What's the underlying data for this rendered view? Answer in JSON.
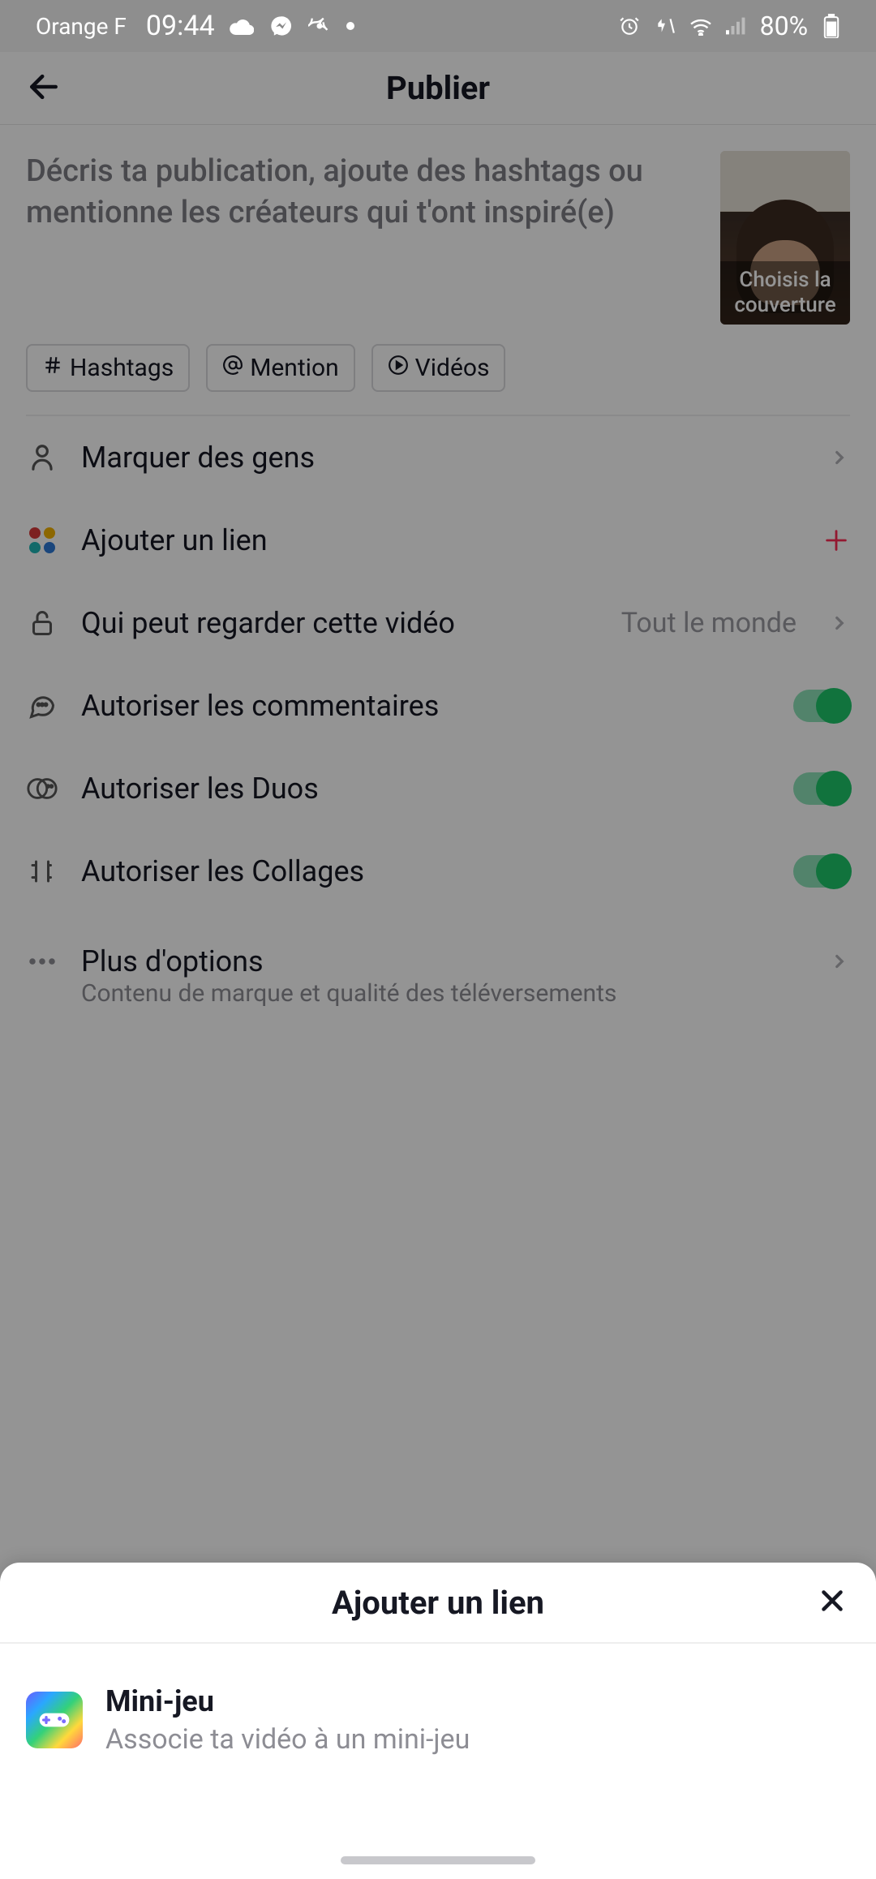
{
  "status": {
    "carrier": "Orange F",
    "time": "09:44",
    "battery": "80%"
  },
  "header": {
    "title": "Publier"
  },
  "compose": {
    "placeholder": "Décris ta publication, ajoute des hashtags ou mentionne les créateurs qui t'ont inspiré(e)",
    "cover_label": "Choisis la couverture"
  },
  "chips": {
    "hashtags": "Hashtags",
    "mention": "Mention",
    "videos": "Vidéos"
  },
  "rows": {
    "tag_people": "Marquer des gens",
    "add_link": "Ajouter un lien",
    "privacy_label": "Qui peut regarder cette vidéo",
    "privacy_value": "Tout le monde",
    "allow_comments": "Autoriser les commentaires",
    "allow_duets": "Autoriser les Duos",
    "allow_stitch": "Autoriser les Collages",
    "more_options": "Plus d'options",
    "more_options_sub": "Contenu de marque et qualité des téléversements"
  },
  "toggles": {
    "comments": true,
    "duets": true,
    "stitch": true
  },
  "sheet": {
    "title": "Ajouter un lien",
    "item_title": "Mini-jeu",
    "item_sub": "Associe ta vidéo à un mini-jeu"
  }
}
